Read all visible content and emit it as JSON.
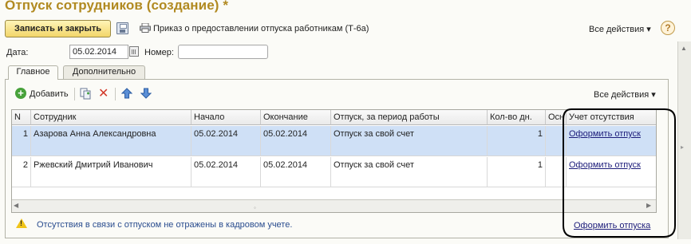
{
  "window": {
    "title": "Отпуск сотрудников (создание) *"
  },
  "toolbar": {
    "save_close_label": "Записать и закрыть",
    "print_label": "Приказ о предоставлении отпуска работникам (Т-6а)",
    "all_actions_label": "Все действия ▾",
    "help_label": "?"
  },
  "form": {
    "date_label": "Дата:",
    "date_value": "05.02.2014",
    "number_label": "Номер:",
    "number_value": ""
  },
  "tabs": [
    {
      "label": "Главное",
      "active": true
    },
    {
      "label": "Дополнительно",
      "active": false
    }
  ],
  "table_toolbar": {
    "add_label": "Добавить",
    "all_actions_label": "Все действия ▾"
  },
  "grid": {
    "columns": [
      "N",
      "Сотрудник",
      "Начало",
      "Окончание",
      "Отпуск, за период работы",
      "Кол-во дн.",
      "Осн",
      "Учет отсутствия"
    ],
    "rows": [
      {
        "n": "1",
        "employee": "Азарова Анна Александровна",
        "start": "05.02.2014",
        "end": "05.02.2014",
        "vacation": "Отпуск за свой счет",
        "days": "1",
        "basis": "",
        "absence": "Оформить отпуск",
        "selected": true
      },
      {
        "n": "2",
        "employee": "Ржевский Дмитрий Иванович",
        "start": "05.02.2014",
        "end": "05.02.2014",
        "vacation": "Отпуск за свой счет",
        "days": "1",
        "basis": "",
        "absence": "Оформить отпуск",
        "selected": false
      }
    ]
  },
  "footer": {
    "warning_text": "Отсутствия в связи с отпуском не отражены в кадровом учете.",
    "link_label": "Оформить отпуска"
  },
  "colors": {
    "title": "#b18a21",
    "primary_button": "#f2d66a",
    "selected_row": "#cfe0f6",
    "link": "#1c1c7a",
    "annotation": "#000000"
  },
  "icons": [
    "save-disk-icon",
    "printer-icon",
    "help-icon",
    "calendar-icon",
    "add-icon",
    "copy-icon",
    "delete-icon",
    "move-up-icon",
    "move-down-icon",
    "warning-icon"
  ]
}
